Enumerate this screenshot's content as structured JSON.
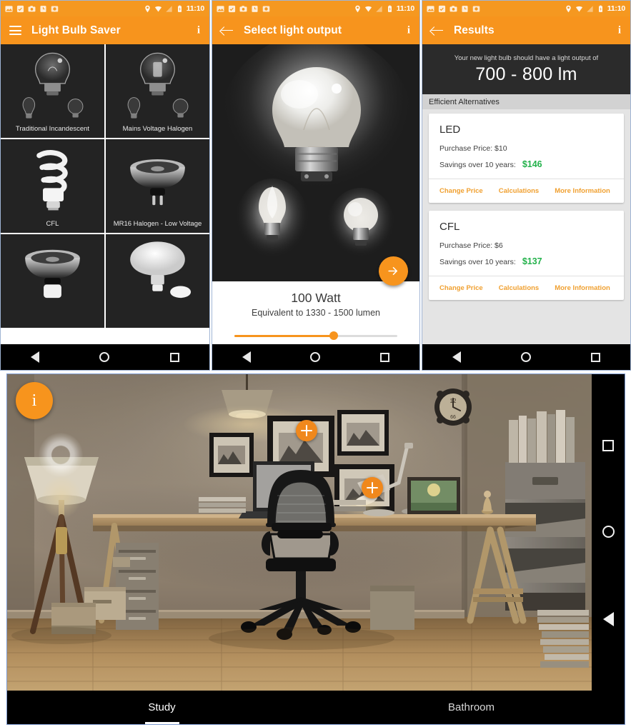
{
  "status_bar": {
    "time": "11:10",
    "left_icons": [
      "image-icon",
      "screenshot-icon",
      "camera-icon",
      "alarm-icon",
      "download-icon"
    ],
    "right_icons": [
      "location-icon",
      "wifi-icon",
      "signal-icon",
      "battery-icon"
    ]
  },
  "panel1": {
    "title": "Light Bulb Saver",
    "menu_icon": "hamburger-menu-icon",
    "info_icon": "info-icon",
    "info_label": "i",
    "bulbs": [
      {
        "label": "Traditional Incandescent",
        "art": "incandescent"
      },
      {
        "label": "Mains Voltage Halogen",
        "art": "halogen"
      },
      {
        "label": "CFL",
        "art": "cfl"
      },
      {
        "label": "MR16 Halogen - Low Voltage",
        "art": "mr16"
      },
      {
        "label": "",
        "art": "gu10"
      },
      {
        "label": "",
        "art": "reflector"
      }
    ]
  },
  "panel2": {
    "title": "Select light output",
    "back_icon": "back-arrow-icon",
    "info_label": "i",
    "watt": "100 Watt",
    "equivalent": "Equivalent to 1330 - 1500 lumen",
    "slider": {
      "value_percent": 61
    },
    "next_icon": "arrow-right-icon"
  },
  "panel3": {
    "title": "Results",
    "back_icon": "back-arrow-icon",
    "info_label": "i",
    "headline": "Your new light bulb should have a light output of",
    "output": "700 - 800 lm",
    "section_title": "Efficient Alternatives",
    "cards": [
      {
        "name": "LED",
        "price_label": "Purchase Price: $10",
        "savings_label": "Savings over 10 years:",
        "savings_value": "$146",
        "actions": [
          "Change Price",
          "Calculations",
          "More Information"
        ]
      },
      {
        "name": "CFL",
        "price_label": "Purchase Price: $6",
        "savings_label": "Savings over 10 years:",
        "savings_value": "$137",
        "actions": [
          "Change Price",
          "Calculations",
          "More Information"
        ]
      }
    ]
  },
  "room_panel": {
    "info_label": "i",
    "info_icon": "info-icon",
    "markers": [
      {
        "name": "add-light-marker-1",
        "icon": "plus-icon"
      },
      {
        "name": "add-light-marker-2",
        "icon": "plus-icon"
      }
    ],
    "selected_bulb_marker": "bulb-highlight-ring",
    "tabs": [
      {
        "label": "Study",
        "active": true
      },
      {
        "label": "Bathroom",
        "active": false
      }
    ],
    "nav_icons": [
      "recent-apps-icon",
      "home-icon",
      "back-icon"
    ],
    "scene": "study-room-with-desk-chair-lamps"
  },
  "colors": {
    "accent": "#f7941d",
    "status_bar": "#f59820",
    "savings_green": "#24b24c",
    "dark_panel": "#232323",
    "results_header": "#2b2b2b",
    "link_orange": "#f0a030"
  }
}
